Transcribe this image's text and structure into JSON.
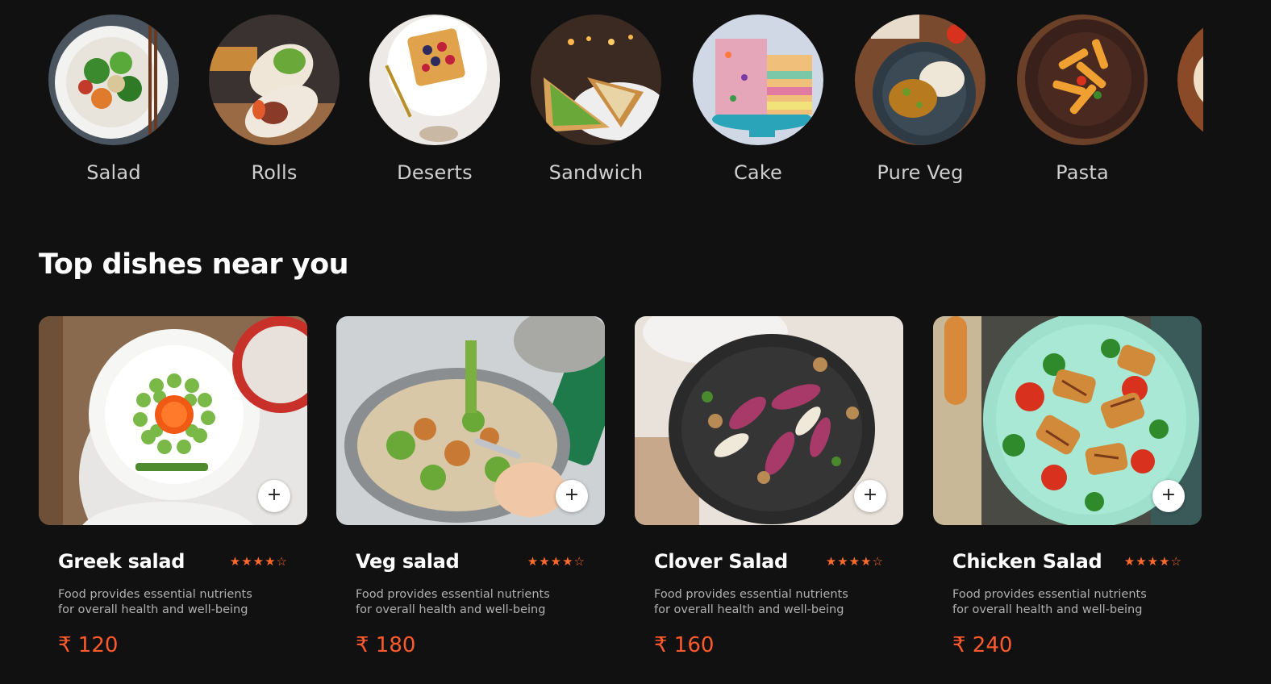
{
  "categories": [
    {
      "label": "Salad",
      "icon": "salad-image"
    },
    {
      "label": "Rolls",
      "icon": "rolls-image"
    },
    {
      "label": "Deserts",
      "icon": "deserts-image"
    },
    {
      "label": "Sandwich",
      "icon": "sandwich-image"
    },
    {
      "label": "Cake",
      "icon": "cake-image"
    },
    {
      "label": "Pure Veg",
      "icon": "pure-veg-image"
    },
    {
      "label": "Pasta",
      "icon": "pasta-image"
    }
  ],
  "section": {
    "title": "Top dishes near you"
  },
  "dishes": [
    {
      "name": "Greek salad",
      "rating": 4,
      "rating_max": 5,
      "description": "Food provides essential nutrients for overall health and well-being",
      "price": "₹ 120",
      "add_label": "+"
    },
    {
      "name": "Veg salad",
      "rating": 4,
      "rating_max": 5,
      "description": "Food provides essential nutrients for overall health and well-being",
      "price": "₹ 180",
      "add_label": "+"
    },
    {
      "name": "Clover Salad",
      "rating": 4,
      "rating_max": 5,
      "description": "Food provides essential nutrients for overall health and well-being",
      "price": "₹ 160",
      "add_label": "+"
    },
    {
      "name": "Chicken Salad",
      "rating": 4,
      "rating_max": 5,
      "description": "Food provides essential nutrients for overall health and well-being",
      "price": "₹ 240",
      "add_label": "+"
    }
  ],
  "colors": {
    "background": "#111111",
    "accent": "#ff5a2c",
    "star": "#ff6a2a"
  }
}
